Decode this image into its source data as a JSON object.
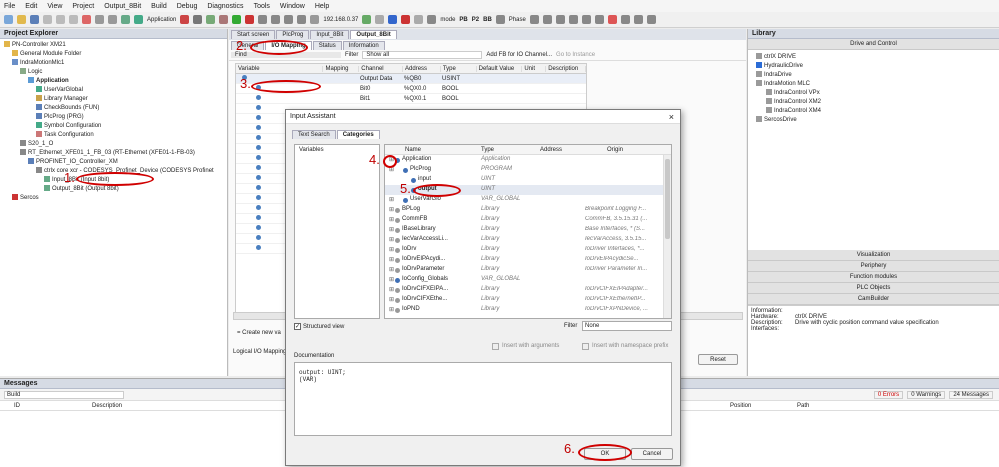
{
  "menu": [
    "File",
    "Edit",
    "View",
    "Project",
    "Output_8Bit",
    "Build",
    "Debug",
    "Diagnostics",
    "Tools",
    "Window",
    "Help"
  ],
  "toolbar": {
    "application": "Application",
    "ip": "192.168.0.37",
    "mode": "mode",
    "pb": "PB",
    "p2": "P2",
    "bb": "BB",
    "phase": "Phase"
  },
  "project_explorer": {
    "title": "Project Explorer",
    "items": [
      {
        "t": "PN-Controller XM21",
        "l": 0
      },
      {
        "t": "General Module Folder",
        "l": 1
      },
      {
        "t": "IndraMotionMlc1",
        "l": 1
      },
      {
        "t": "Logic",
        "l": 2
      },
      {
        "t": "Application",
        "l": 3
      },
      {
        "t": "UserVarGlobal",
        "l": 4
      },
      {
        "t": "Library Manager",
        "l": 4
      },
      {
        "t": "CheckBounds (FUN)",
        "l": 4
      },
      {
        "t": "PlcProg (PRG)",
        "l": 4
      },
      {
        "t": "Symbol Configuration",
        "l": 4
      },
      {
        "t": "Task Configuration",
        "l": 4
      },
      {
        "t": "S20_1_O",
        "l": 2
      },
      {
        "t": "RT_Ethernet_XFE01_1_FB_03 (RT-Ethernet (XFE01-1-FB-03)",
        "l": 2
      },
      {
        "t": "PROFINET_IO_Controller_XM",
        "l": 3
      },
      {
        "t": "ctrlx core xcr - CODESYS_Profinet_Device (CODESYS Profinet",
        "l": 4
      },
      {
        "t": "Input_8Bit (Input 8bit)",
        "l": 5
      },
      {
        "t": "Output_8Bit (Output 8bit)",
        "l": 5
      },
      {
        "t": "Sercos",
        "l": 1
      }
    ]
  },
  "editor": {
    "tabs": [
      "Start screen",
      "PlcProg",
      "Input_8Bit",
      "Output_8Bit"
    ],
    "subtabs": [
      "General",
      "I/O Mapping",
      "Status",
      "Information"
    ],
    "find": "Find",
    "filter": "Filter",
    "show_all": "Show all",
    "add_fb": "Add FB for IO Channel...",
    "goto": "Go to Instance",
    "columns": [
      "Variable",
      "Mapping",
      "Channel",
      "Address",
      "Type",
      "Default Value",
      "Unit",
      "Description"
    ],
    "rows": [
      {
        "channel": "Output Data",
        "address": "%QB0",
        "type": "USINT"
      },
      {
        "channel": "Bit0",
        "address": "%QX0.0",
        "type": "BOOL"
      },
      {
        "channel": "Bit1",
        "address": "%QX0.1",
        "type": "BOOL"
      }
    ],
    "create_new": "= Create new va",
    "logical": "Logical I/O Mapping",
    "reset": "Reset"
  },
  "dialog": {
    "title": "Input Assistant",
    "tabs": [
      "Text Search",
      "Categories"
    ],
    "categories": [
      "Variables"
    ],
    "columns": [
      "Name",
      "Type",
      "Address",
      "Origin"
    ],
    "rows": [
      {
        "name": "Application",
        "type": "Application",
        "origin": "",
        "l": 0
      },
      {
        "name": "PlcProg",
        "type": "PROGRAM",
        "origin": "",
        "l": 1
      },
      {
        "name": "input",
        "type": "UINT",
        "origin": "",
        "l": 2
      },
      {
        "name": "output",
        "type": "UINT",
        "origin": "",
        "l": 2
      },
      {
        "name": "UserVarGlo",
        "type": "VAR_GLOBAL",
        "origin": "",
        "l": 1
      },
      {
        "name": "BPLog",
        "type": "Library",
        "origin": "Breakpoint Logging F...",
        "l": 0
      },
      {
        "name": "CommFB",
        "type": "Library",
        "origin": "CommFB, 3.5.15.31 (...",
        "l": 0
      },
      {
        "name": "IBaseLibrary",
        "type": "Library",
        "origin": "Base Interfaces, * (S...",
        "l": 0
      },
      {
        "name": "IecVarAccessLi...",
        "type": "Library",
        "origin": "IecVarAccess, 3.5.15...",
        "l": 0
      },
      {
        "name": "IoDrv",
        "type": "Library",
        "origin": "IoDriver Interfaces, *...",
        "l": 0
      },
      {
        "name": "IoDrvEIPAcydi...",
        "type": "Library",
        "origin": "IoDrvEIPAcydicSe...",
        "l": 0
      },
      {
        "name": "IoDrvParameter",
        "type": "Library",
        "origin": "IoDriver Parameter In...",
        "l": 0
      },
      {
        "name": "IoConfig_Globals",
        "type": "VAR_GLOBAL",
        "origin": "",
        "l": 0
      },
      {
        "name": "IoDrvCIFXEIPA...",
        "type": "Library",
        "origin": "IoDrvCIFXEIPAdapter...",
        "l": 0
      },
      {
        "name": "IoDrvCIFXEthe...",
        "type": "Library",
        "origin": "IoDrvCIFXEthernetIP...",
        "l": 0
      },
      {
        "name": "IoPND",
        "type": "Library",
        "origin": "IoDrvCIFXPNDevice, ...",
        "l": 0
      }
    ],
    "structured": "Structured view",
    "filter_label": "Filter",
    "filter_value": "None",
    "insert_args": "Insert with arguments",
    "insert_ns": "Insert with namespace prefix",
    "doc_label": "Documentation",
    "doc_text": "output: UINT;\n(VAR)",
    "ok": "OK",
    "cancel": "Cancel"
  },
  "library": {
    "title": "Library",
    "section": "Drive and Control",
    "items": [
      {
        "t": "ctrlX DRIVE",
        "l": 0
      },
      {
        "t": "HydraulicDrive",
        "l": 0
      },
      {
        "t": "IndraDrive",
        "l": 0
      },
      {
        "t": "IndraMotion MLC",
        "l": 0
      },
      {
        "t": "IndraControl VPx",
        "l": 1
      },
      {
        "t": "IndraControl XM2",
        "l": 1
      },
      {
        "t": "IndraControl XM4",
        "l": 1
      },
      {
        "t": "SercosDrive",
        "l": 0
      }
    ],
    "groups": [
      "Visualization",
      "Periphery",
      "Function modules",
      "PLC Objects",
      "CamBuilder"
    ],
    "info_label": "Information:",
    "info": [
      {
        "k": "Hardware:",
        "v": "ctrlX DRIVE"
      },
      {
        "k": "Description:",
        "v": "Drive with cyclic position command value specification"
      },
      {
        "k": "Interfaces:",
        "v": ""
      }
    ]
  },
  "messages": {
    "title": "Messages",
    "build": "Build",
    "errors": "0 Errors",
    "warnings": "0 Warnings",
    "msgs": "24 Messages",
    "columns": [
      "ID",
      "Description",
      "Position",
      "Path"
    ]
  },
  "callouts": [
    "1.",
    "2.",
    "3.",
    "4.",
    "5.",
    "6."
  ]
}
